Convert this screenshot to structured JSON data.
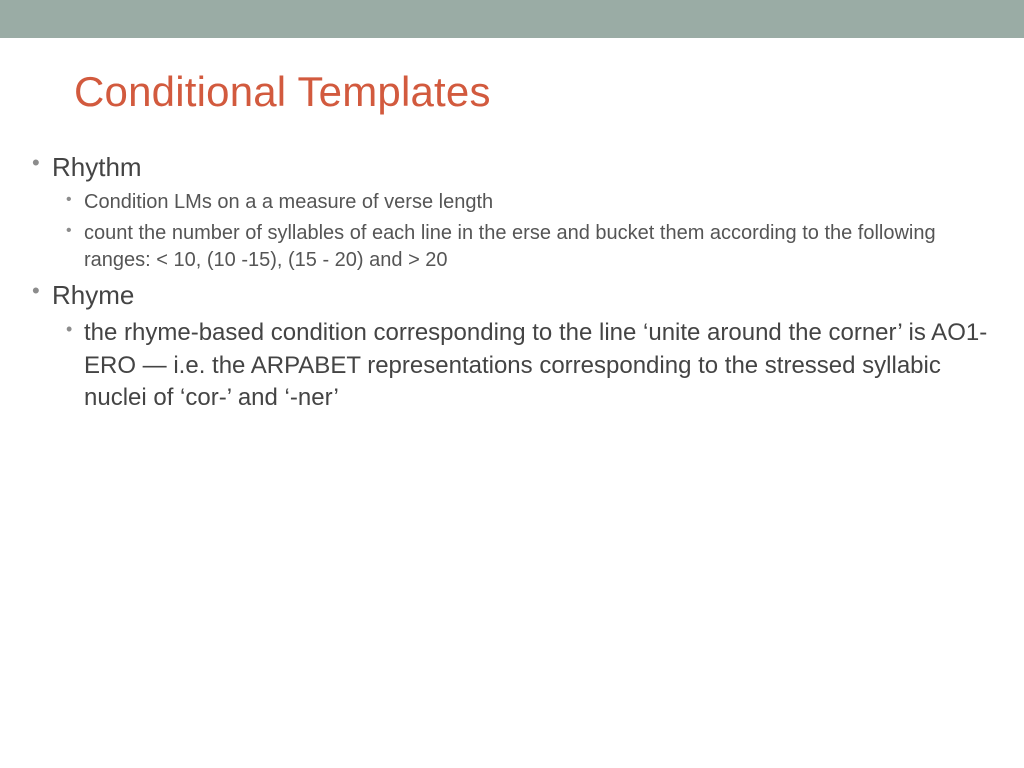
{
  "title": "Conditional Templates",
  "bullets": [
    {
      "label": "Rhythm",
      "children": [
        {
          "label": "Condition LMs on a a measure of verse length"
        },
        {
          "label": "count the number of syllables of each line in the erse and bucket them according to the following ranges: < 10, (10 -15), (15 - 20) and > 20"
        }
      ]
    },
    {
      "label": "Rhyme",
      "children": [
        {
          "label": "the rhyme-based condition corresponding to the line ‘unite around the corner’ is AO1-ERO — i.e. the ARPABET representations corresponding to the stressed syllabic nuclei of ‘cor-’ and ‘-ner’"
        }
      ]
    }
  ]
}
